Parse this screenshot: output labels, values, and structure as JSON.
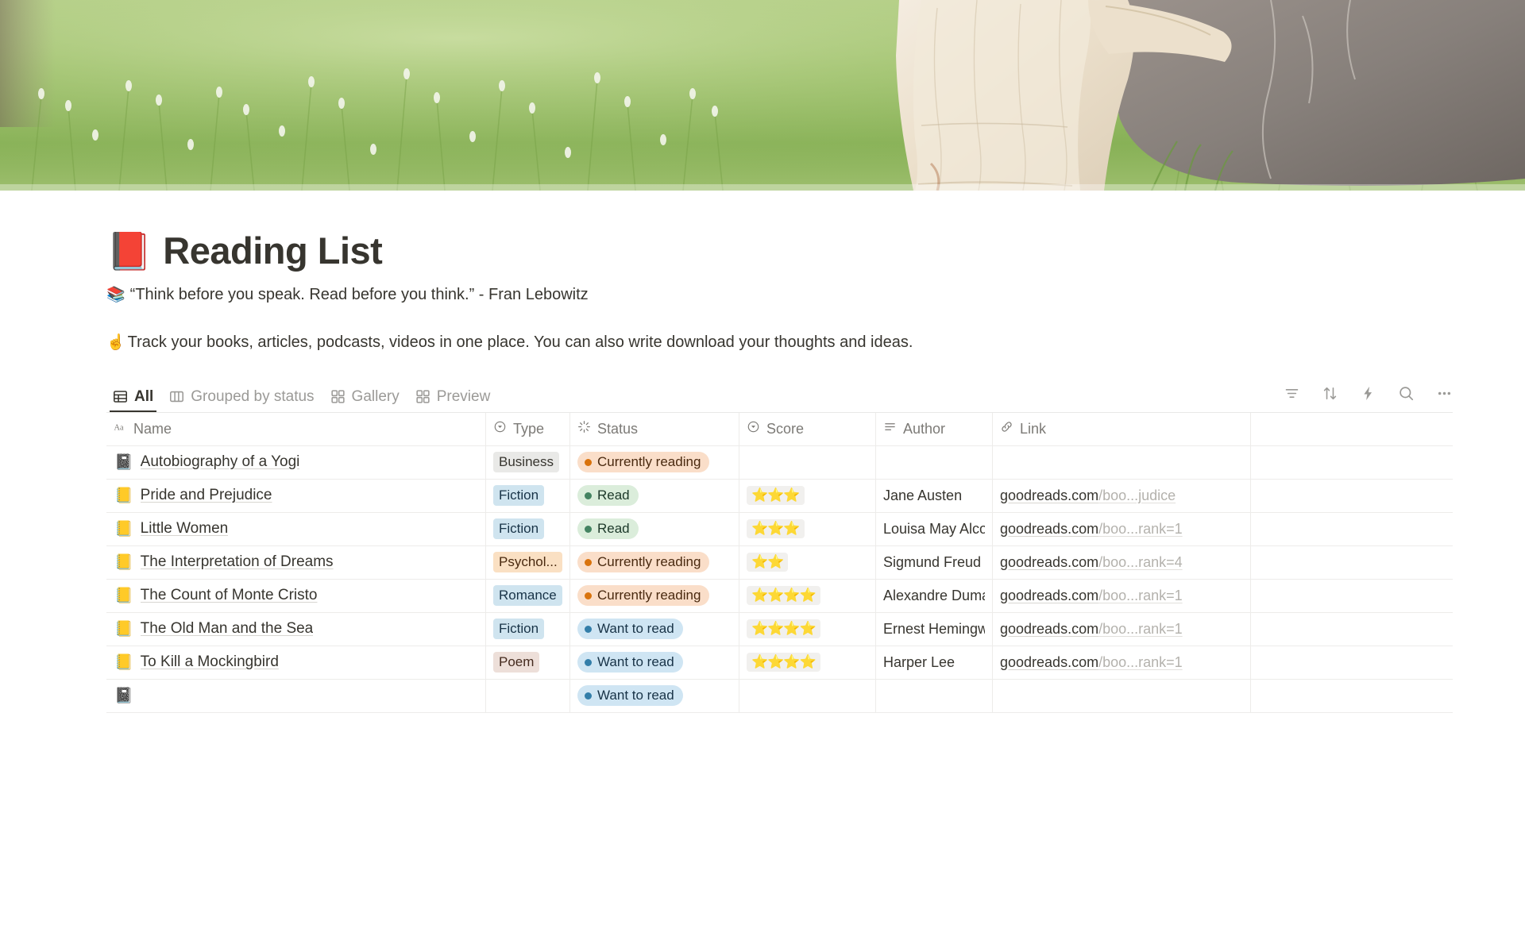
{
  "cover": {
    "alt": "Woman in cream lace dress sitting on a large gray rock in a green meadow with white wildflowers"
  },
  "header": {
    "title_emoji": "📕",
    "title": "Reading List",
    "quote_emoji": "📚",
    "quote": "“Think before you speak. Read before you think.” - Fran Lebowitz",
    "description_emoji": "☝️",
    "description": "Track your books, articles, podcasts, videos in one place. You can also write download your thoughts and ideas."
  },
  "views": [
    {
      "label": "All",
      "icon": "table-icon",
      "active": true
    },
    {
      "label": "Grouped by status",
      "icon": "board-icon",
      "active": false
    },
    {
      "label": "Gallery",
      "icon": "gallery-icon",
      "active": false
    },
    {
      "label": "Preview",
      "icon": "gallery-icon",
      "active": false
    }
  ],
  "toolbar": [
    {
      "name": "filter-icon",
      "title": "Filter"
    },
    {
      "name": "sort-icon",
      "title": "Sort"
    },
    {
      "name": "lightning-icon",
      "title": "Automations"
    },
    {
      "name": "search-icon",
      "title": "Search"
    },
    {
      "name": "more-icon",
      "title": "More options"
    }
  ],
  "table": {
    "columns": [
      {
        "key": "name",
        "label": "Name",
        "icon": "text-type-icon"
      },
      {
        "key": "type",
        "label": "Type",
        "icon": "select-icon"
      },
      {
        "key": "status",
        "label": "Status",
        "icon": "status-spinner-icon"
      },
      {
        "key": "score",
        "label": "Score",
        "icon": "select-icon"
      },
      {
        "key": "author",
        "label": "Author",
        "icon": "text-lines-icon"
      },
      {
        "key": "link",
        "label": "Link",
        "icon": "link-icon"
      }
    ],
    "rows": [
      {
        "icon": "📓",
        "name": "Autobiography of a Yogi",
        "type": "Business",
        "type_color": "gray",
        "status": "Currently reading",
        "status_color": "orange",
        "score": "",
        "author": "",
        "link_host": "",
        "link_path": ""
      },
      {
        "icon": "📒",
        "name": "Pride and Prejudice",
        "type": "Fiction",
        "type_color": "blue",
        "status": "Read",
        "status_color": "green",
        "score": "⭐⭐⭐",
        "author": "Jane Austen",
        "link_host": "goodreads.com",
        "link_path": "/boo...judice"
      },
      {
        "icon": "📒",
        "name": "Little Women",
        "type": "Fiction",
        "type_color": "blue",
        "status": "Read",
        "status_color": "green",
        "score": "⭐⭐⭐",
        "author": "Louisa May Alcott",
        "link_host": "goodreads.com",
        "link_path": "/boo...rank=1"
      },
      {
        "icon": "📒",
        "name": "The Interpretation of Dreams",
        "type": "Psychol...",
        "type_color": "orange",
        "status": "Currently reading",
        "status_color": "orange",
        "score": "⭐⭐",
        "author": "Sigmund Freud",
        "link_host": "goodreads.com",
        "link_path": "/boo...rank=4"
      },
      {
        "icon": "📒",
        "name": "The Count of Monte Cristo",
        "type": "Romance",
        "type_color": "blue",
        "status": "Currently reading",
        "status_color": "orange",
        "score": "⭐⭐⭐⭐",
        "author": "Alexandre Dumas",
        "link_host": "goodreads.com",
        "link_path": "/boo...rank=1"
      },
      {
        "icon": "📒",
        "name": "The Old Man and the Sea",
        "type": "Fiction",
        "type_color": "blue",
        "status": "Want to read",
        "status_color": "blue",
        "score": "⭐⭐⭐⭐",
        "author": "Ernest Hemingway",
        "link_host": "goodreads.com",
        "link_path": "/boo...rank=1"
      },
      {
        "icon": "📒",
        "name": "To Kill a Mockingbird",
        "type": "Poem",
        "type_color": "pink",
        "status": "Want to read",
        "status_color": "blue",
        "score": "⭐⭐⭐⭐",
        "author": "Harper Lee",
        "link_host": "goodreads.com",
        "link_path": "/boo...rank=1"
      },
      {
        "icon": "📓",
        "name": "",
        "type": "",
        "type_color": "",
        "status": "Want to read",
        "status_color": "blue",
        "score": "",
        "author": "",
        "link_host": "",
        "link_path": ""
      }
    ]
  }
}
